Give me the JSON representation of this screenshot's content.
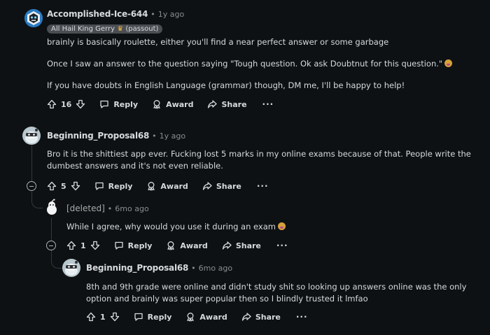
{
  "labels": {
    "reply": "Reply",
    "award": "Award",
    "share": "Share",
    "more": "···",
    "dot": "•"
  },
  "comments": [
    {
      "author": "Accomplished-Ice-644",
      "age": "1y ago",
      "flair": "All Hail King Gerry",
      "flair_extra": "(passout)",
      "paragraphs": [
        "brainly is basically roulette, either you'll find a near perfect answer or some garbage",
        "Once I saw an answer to the question saying \"Tough question. Ok ask Doubtnut for this question.\"",
        "If you have doubts in English Language (grammar) though, DM me, I'll be happy to help!"
      ],
      "votes": "16"
    },
    {
      "author": "Beginning_Proposal68",
      "age": "1y ago",
      "paragraphs": [
        "Bro it is the shittiest app ever. Fucking lost 5 marks in my online exams because of that. People write the dumbest answers and it's not even reliable."
      ],
      "votes": "5"
    },
    {
      "author": "[deleted]",
      "age": "6mo ago",
      "paragraphs": [
        "While I agree, why would you use it during an exam"
      ],
      "votes": "1"
    },
    {
      "author": "Beginning_Proposal68",
      "age": "6mo ago",
      "paragraphs": [
        "8th and 9th grade were online and didn't study shit so looking up answers online was the only option and brainly was super popular then so I blindly trusted it lmfao"
      ],
      "votes": "1"
    }
  ]
}
